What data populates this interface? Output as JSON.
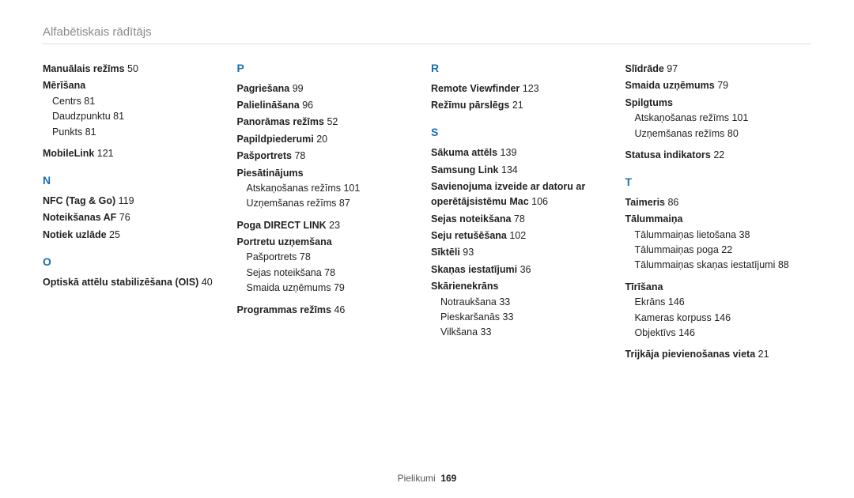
{
  "header": "Alfabētiskais rādītājs",
  "footer": {
    "label": "Pielikumi",
    "page": "169"
  },
  "cols": [
    [
      {
        "t": "entry",
        "label": "Manuālais režīms",
        "pg": "50"
      },
      {
        "t": "group",
        "label": "Mērīšana",
        "subs": [
          {
            "label": "Centrs",
            "pg": "81"
          },
          {
            "label": "Daudzpunktu",
            "pg": "81"
          },
          {
            "label": "Punkts",
            "pg": "81"
          }
        ]
      },
      {
        "t": "entry",
        "label": "MobileLink",
        "pg": "121",
        "gapTop": true
      },
      {
        "t": "letter",
        "label": "N"
      },
      {
        "t": "entry",
        "label": "NFC (Tag & Go)",
        "pg": "119"
      },
      {
        "t": "entry",
        "label": "Noteikšanas AF",
        "pg": "76"
      },
      {
        "t": "entry",
        "label": "Notiek uzlāde",
        "pg": "25"
      },
      {
        "t": "letter",
        "label": "O"
      },
      {
        "t": "entry",
        "label": "Optiskā attēlu stabilizēšana (OIS)",
        "pg": "40"
      }
    ],
    [
      {
        "t": "letter",
        "label": "P"
      },
      {
        "t": "entry",
        "label": "Pagriešana",
        "pg": "99"
      },
      {
        "t": "entry",
        "label": "Palielināšana",
        "pg": "96"
      },
      {
        "t": "entry",
        "label": "Panorāmas režīms",
        "pg": "52"
      },
      {
        "t": "entry",
        "label": "Papildpiederumi",
        "pg": "20"
      },
      {
        "t": "entry",
        "label": "Pašportrets",
        "pg": "78"
      },
      {
        "t": "group",
        "label": "Piesātinājums",
        "subs": [
          {
            "label": "Atskaņošanas režīms",
            "pg": "101"
          },
          {
            "label": "Uzņemšanas režīms",
            "pg": "87"
          }
        ]
      },
      {
        "t": "entry",
        "label": "Poga DIRECT LINK",
        "pg": "23",
        "gapTop": true
      },
      {
        "t": "group",
        "label": "Portretu uzņemšana",
        "subs": [
          {
            "label": "Pašportrets",
            "pg": "78"
          },
          {
            "label": "Sejas noteikšana",
            "pg": "78"
          },
          {
            "label": "Smaida uzņēmums",
            "pg": "79"
          }
        ]
      },
      {
        "t": "entry",
        "label": "Programmas režīms",
        "pg": "46",
        "gapTop": true
      }
    ],
    [
      {
        "t": "letter",
        "label": "R"
      },
      {
        "t": "entry",
        "label": "Remote Viewfinder",
        "pg": "123"
      },
      {
        "t": "entry",
        "label": "Režīmu pārslēgs",
        "pg": "21"
      },
      {
        "t": "letter",
        "label": "S"
      },
      {
        "t": "entry",
        "label": "Sākuma attēls",
        "pg": "139"
      },
      {
        "t": "entry",
        "label": "Samsung Link",
        "pg": "134"
      },
      {
        "t": "entry",
        "label": "Savienojuma izveide ar datoru ar operētājsistēmu Mac",
        "pg": "106"
      },
      {
        "t": "entry",
        "label": "Sejas noteikšana",
        "pg": "78"
      },
      {
        "t": "entry",
        "label": "Seju retušēšana",
        "pg": "102"
      },
      {
        "t": "entry",
        "label": "Sīktēli",
        "pg": "93"
      },
      {
        "t": "entry",
        "label": "Skaņas iestatījumi",
        "pg": "36"
      },
      {
        "t": "group",
        "label": "Skārienekrāns",
        "subs": [
          {
            "label": "Notraukšana",
            "pg": "33"
          },
          {
            "label": "Pieskaršanās",
            "pg": "33"
          },
          {
            "label": "Vilkšana",
            "pg": "33"
          }
        ]
      }
    ],
    [
      {
        "t": "entry",
        "label": "Slīdrāde",
        "pg": "97"
      },
      {
        "t": "entry",
        "label": "Smaida uzņēmums",
        "pg": "79"
      },
      {
        "t": "group",
        "label": "Spilgtums",
        "subs": [
          {
            "label": "Atskaņošanas režīms",
            "pg": "101"
          },
          {
            "label": "Uzņemšanas režīms",
            "pg": "80"
          }
        ]
      },
      {
        "t": "entry",
        "label": "Statusa indikators",
        "pg": "22",
        "gapTop": true
      },
      {
        "t": "letter",
        "label": "T"
      },
      {
        "t": "entry",
        "label": "Taimeris",
        "pg": "86"
      },
      {
        "t": "group",
        "label": "Tālummaiņa",
        "subs": [
          {
            "label": "Tālummaiņas lietošana",
            "pg": "38"
          },
          {
            "label": "Tālummaiņas poga",
            "pg": "22"
          },
          {
            "label": "Tālummaiņas skaņas iestatījumi",
            "pg": "88"
          }
        ]
      },
      {
        "t": "group",
        "label": "Tīrīšana",
        "gapTop": true,
        "subs": [
          {
            "label": "Ekrāns",
            "pg": "146"
          },
          {
            "label": "Kameras korpuss",
            "pg": "146"
          },
          {
            "label": "Objektīvs",
            "pg": "146"
          }
        ]
      },
      {
        "t": "entry",
        "label": "Trijkāja pievienošanas vieta",
        "pg": "21",
        "gapTop": true
      }
    ]
  ]
}
